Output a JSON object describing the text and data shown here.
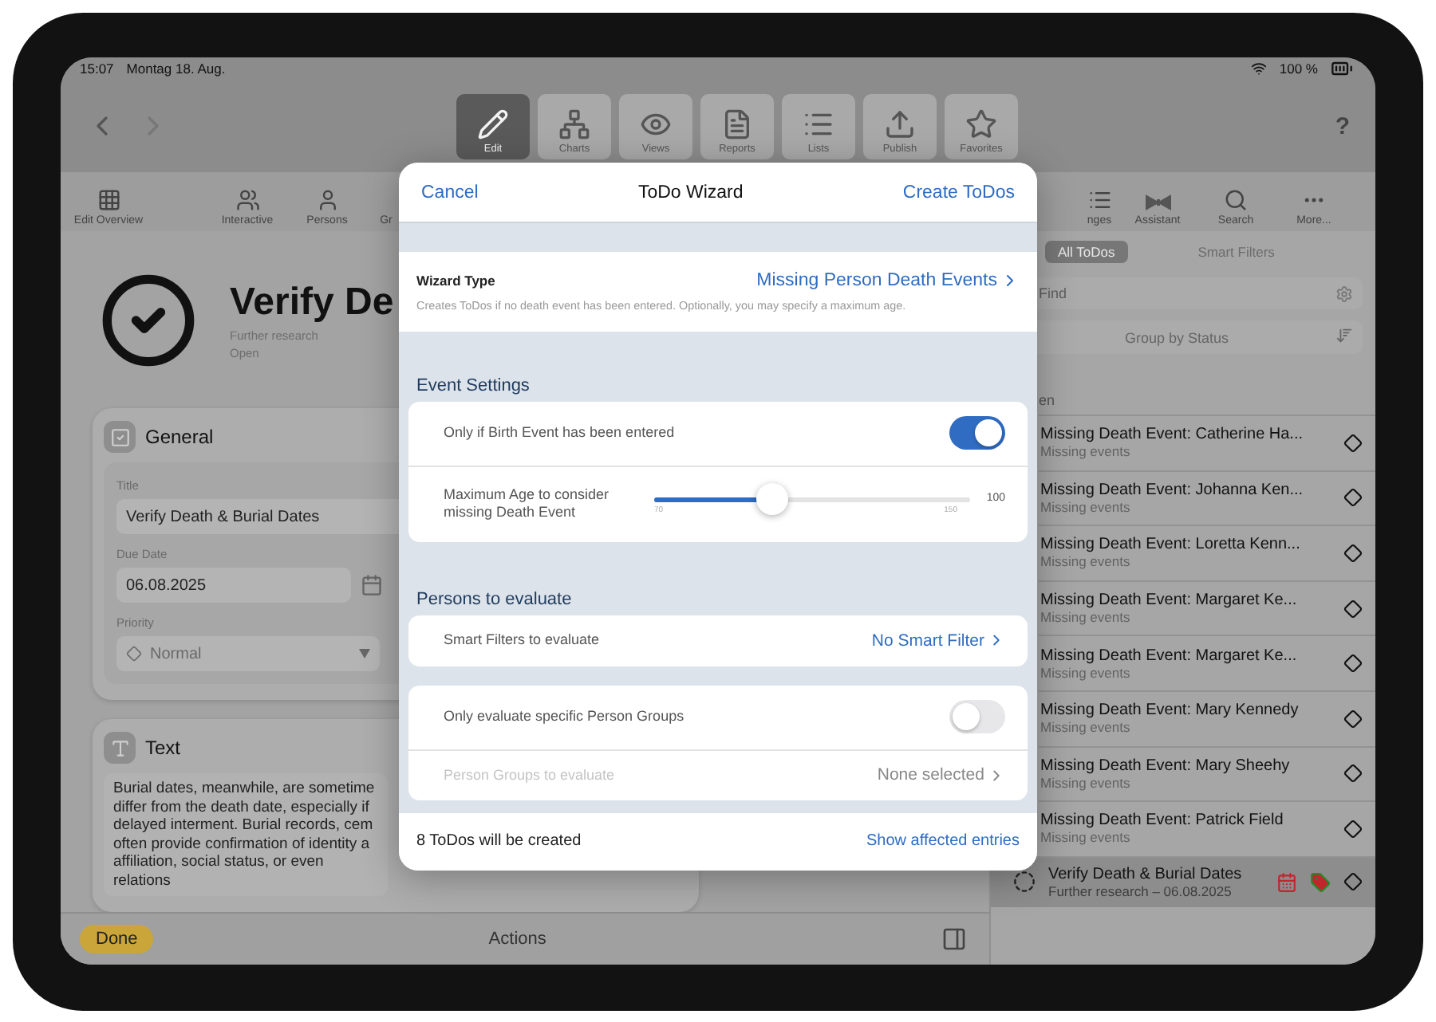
{
  "status_bar": {
    "time": "15:07",
    "date": "Montag 18. Aug.",
    "battery": "100 %"
  },
  "toolbar": {
    "help": "?",
    "buttons": [
      {
        "label": "Edit",
        "selected": true
      },
      {
        "label": "Charts",
        "selected": false
      },
      {
        "label": "Views",
        "selected": false
      },
      {
        "label": "Reports",
        "selected": false
      },
      {
        "label": "Lists",
        "selected": false
      },
      {
        "label": "Publish",
        "selected": false
      },
      {
        "label": "Favorites",
        "selected": false
      }
    ]
  },
  "secondary_toolbar": {
    "left": [
      {
        "label": "Edit Overview"
      },
      {
        "label": "Interactive"
      },
      {
        "label": "Persons"
      },
      {
        "label": "Gr"
      }
    ],
    "right": [
      {
        "label": "nges"
      },
      {
        "label": "Assistant"
      },
      {
        "label": "Search"
      },
      {
        "label": "More..."
      }
    ]
  },
  "todo": {
    "title": "Verify De",
    "category": "Further research",
    "status": "Open",
    "general": {
      "heading": "General",
      "fields": [
        {
          "kind": "text",
          "label": "Title",
          "value": "Verify Death & Burial Dates"
        },
        {
          "kind": "date",
          "label": "Due Date",
          "value": "06.08.2025"
        },
        {
          "kind": "select",
          "label": "Priority",
          "value": "Normal"
        }
      ]
    },
    "text": {
      "heading": "Text",
      "body": "Burial dates, meanwhile, are sometime differ from the death date, especially if delayed interment. Burial records, cem often provide confirmation of identity a affiliation, social status, or even relations"
    }
  },
  "bottom_bar": {
    "done": "Done",
    "actions": "Actions"
  },
  "wizard": {
    "cancel": "Cancel",
    "title": "ToDo Wizard",
    "confirm": "Create ToDos",
    "type": {
      "label": "Wizard Type",
      "value": "Missing Person Death Events",
      "description": "Creates ToDos if no death event has been entered. Optionally, you may specify a maximum age."
    },
    "sections": [
      {
        "heading": "Event Settings",
        "cards": [
          {
            "rows": [
              {
                "kind": "toggle",
                "label": "Only if Birth Event has been entered",
                "on": true
              },
              {
                "kind": "slider",
                "label": "Maximum Age to consider missing Death Event",
                "level": 0.375,
                "reading": "100",
                "min_label": "70",
                "max_label": "150"
              }
            ]
          }
        ]
      },
      {
        "heading": "Persons to evaluate",
        "cards": [
          {
            "rows": [
              {
                "kind": "link",
                "label": "Smart Filters to evaluate",
                "value": "No Smart Filter",
                "disabled": false
              }
            ]
          },
          {
            "rows": [
              {
                "kind": "toggle",
                "label": "Only evaluate specific Person Groups",
                "on": false
              },
              {
                "kind": "link",
                "label": "Person Groups to evaluate",
                "value": "None selected",
                "disabled": true
              }
            ]
          }
        ]
      }
    ],
    "footer": {
      "count": "8 ToDos will be created",
      "link": "Show affected entries"
    }
  },
  "todo_list": {
    "filters": [
      {
        "label": "All ToDos",
        "selected": true
      },
      {
        "label": "Smart Filters",
        "selected": false
      }
    ],
    "search": {
      "placeholder": "Find"
    },
    "group_by": "Group by Status",
    "section": "en",
    "items": [
      {
        "kind": "event",
        "title": "Missing Death Event: Catherine Ha...",
        "subtitle": "Missing events",
        "selected": false
      },
      {
        "kind": "event",
        "title": "Missing Death Event: Johanna Ken...",
        "subtitle": "Missing events",
        "selected": false
      },
      {
        "kind": "event",
        "title": "Missing Death Event: Loretta Kenn...",
        "subtitle": "Missing events",
        "selected": false
      },
      {
        "kind": "event",
        "title": "Missing Death Event: Margaret Ke...",
        "subtitle": "Missing events",
        "selected": false
      },
      {
        "kind": "event",
        "title": "Missing Death Event: Margaret Ke...",
        "subtitle": "Missing events",
        "selected": false
      },
      {
        "kind": "event",
        "title": "Missing Death Event: Mary Kennedy",
        "subtitle": "Missing events",
        "selected": false
      },
      {
        "kind": "event",
        "title": "Missing Death Event: Mary Sheehy",
        "subtitle": "Missing events",
        "selected": false
      },
      {
        "kind": "event",
        "title": "Missing Death Event: Patrick Field",
        "subtitle": "Missing events",
        "selected": false
      },
      {
        "kind": "task",
        "title": "Verify Death & Burial Dates",
        "subtitle": "Further research – 06.08.2025",
        "selected": true
      }
    ]
  }
}
